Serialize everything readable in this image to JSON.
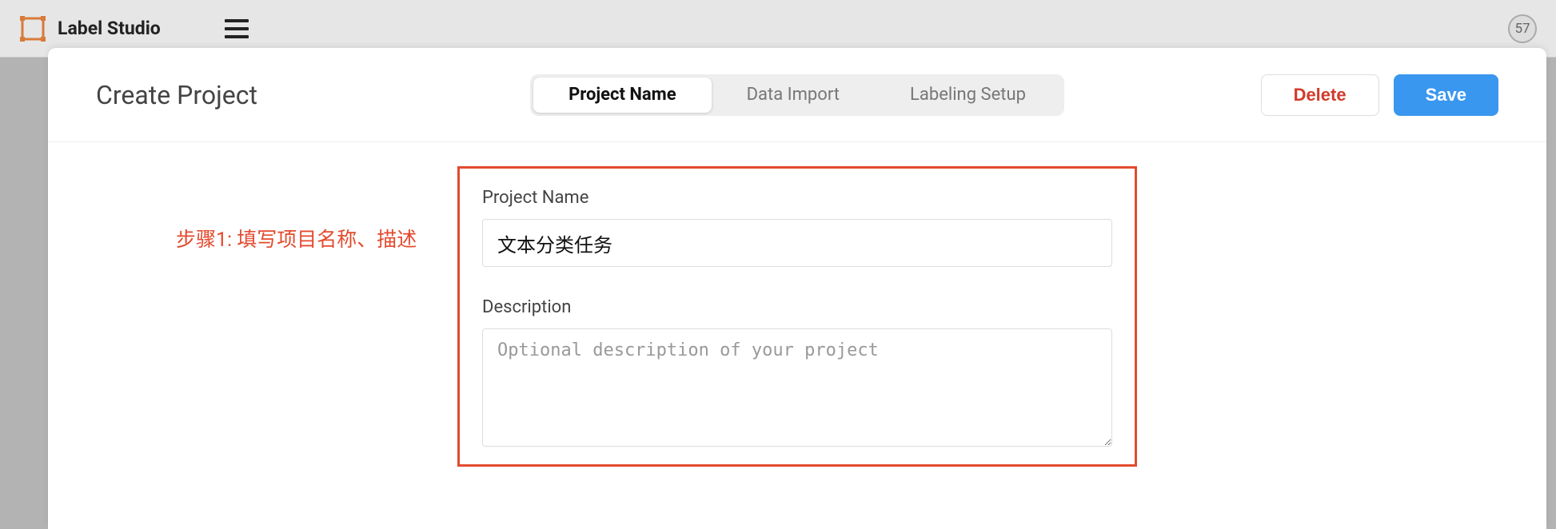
{
  "header": {
    "app_name": "Label Studio",
    "badge_count": "57"
  },
  "modal": {
    "title": "Create Project",
    "tabs": {
      "project_name": "Project Name",
      "data_import": "Data Import",
      "labeling_setup": "Labeling Setup"
    },
    "actions": {
      "delete": "Delete",
      "save": "Save"
    }
  },
  "annotation": {
    "step1": "步骤1: 填写项目名称、描述"
  },
  "form": {
    "project_name_label": "Project Name",
    "project_name_value": "文本分类任务",
    "description_label": "Description",
    "description_placeholder": "Optional description of your project",
    "description_value": ""
  }
}
